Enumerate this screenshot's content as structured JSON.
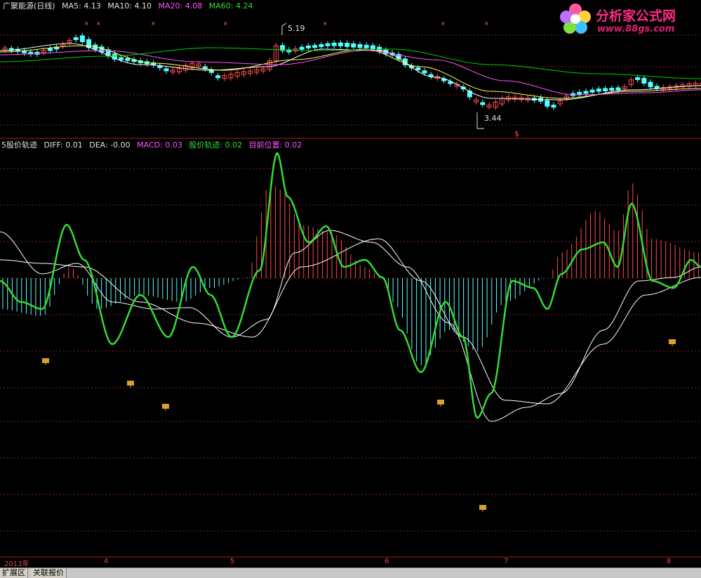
{
  "main_pane": {
    "title": "广聚能源(日线)",
    "ma5_label": "MA5:",
    "ma5_value": "4.13",
    "ma10_label": "MA10:",
    "ma10_value": "4.10",
    "ma20_label": "MA20:",
    "ma20_value": "4.08",
    "ma60_label": "MA60:",
    "ma60_value": "4.24",
    "high_annotation": "5.19",
    "low_annotation": "3.44",
    "signal_mark": "$",
    "colors": {
      "up": "#ff4a4a",
      "down": "#54ffff",
      "ma5": "#ffffff",
      "ma10": "#ffff54",
      "ma20": "#ff54ff",
      "ma60": "#00cc00"
    }
  },
  "sub_pane": {
    "title": "5股价轨迹",
    "diff_label": "DIFF:",
    "diff_value": "0.01",
    "dea_label": "DEA:",
    "dea_value": "-0.00",
    "macd_label": "MACD:",
    "macd_value": "0.03",
    "track_label": "股价轨迹:",
    "track_value": "0.02",
    "pos_label": "目前位置:",
    "pos_value": "0.02",
    "colors": {
      "diff": "#ffffff",
      "dea": "#ffffff",
      "macd_pos": "#ff4a4a",
      "macd_neg": "#54ffff",
      "track": "#33dd33",
      "pos": "#ff54ff"
    }
  },
  "logo": {
    "title": "分析家公式网",
    "url": "www.88gs.com"
  },
  "date_axis": {
    "labels": [
      "2013年",
      "4",
      "5",
      "6",
      "7",
      "8"
    ]
  },
  "tabs": [
    "扩展区",
    "关联报价"
  ]
}
